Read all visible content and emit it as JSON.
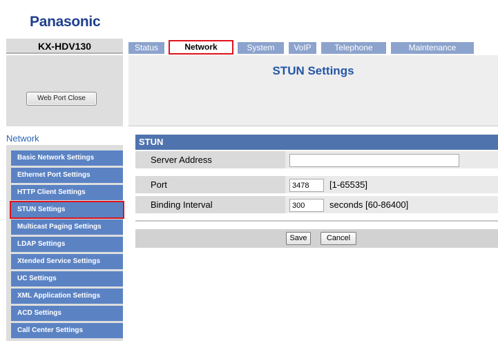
{
  "brand": {
    "logo": "Panasonic",
    "model": "KX-HDV130"
  },
  "tabs": [
    {
      "label": "Status",
      "active": false
    },
    {
      "label": "Network",
      "active": true
    },
    {
      "label": "System",
      "active": false
    },
    {
      "label": "VoIP",
      "active": false
    },
    {
      "label": "Telephone",
      "active": false
    },
    {
      "label": "Maintenance",
      "active": false
    }
  ],
  "sidebar": {
    "web_port_button": "Web Port Close",
    "section_title": "Network",
    "items": [
      {
        "label": "Basic Network Settings"
      },
      {
        "label": "Ethernet Port Settings"
      },
      {
        "label": "HTTP Client Settings"
      },
      {
        "label": "STUN Settings",
        "selected": true
      },
      {
        "label": "Multicast Paging Settings"
      },
      {
        "label": "LDAP Settings"
      },
      {
        "label": "Xtended Service Settings"
      },
      {
        "label": "UC Settings"
      },
      {
        "label": "XML Application Settings"
      },
      {
        "label": "ACD Settings"
      },
      {
        "label": "Call Center Settings"
      }
    ]
  },
  "page": {
    "title": "STUN Settings",
    "section": "STUN",
    "fields": {
      "server_address": {
        "label": "Server Address",
        "value": ""
      },
      "port": {
        "label": "Port",
        "value": "3478",
        "hint": "[1-65535]"
      },
      "binding_interval": {
        "label": "Binding Interval",
        "value": "300",
        "hint": "seconds [60-86400]"
      }
    },
    "buttons": {
      "save": "Save",
      "cancel": "Cancel"
    }
  },
  "colors": {
    "accent_blue": "#4f73ad",
    "nav_blue": "#5b83c4",
    "tab_blue": "#8ca3cd",
    "highlight_red": "#e0111a",
    "logo_blue": "#1f3f8f"
  }
}
